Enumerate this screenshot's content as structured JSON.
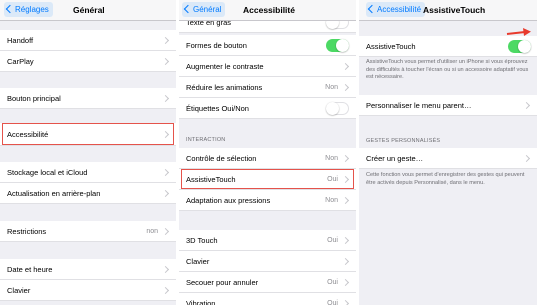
{
  "panel1": {
    "back_label": "Réglages",
    "title": "Général",
    "rows": [
      {
        "label": "Handoff"
      },
      {
        "label": "CarPlay"
      },
      {
        "label": "Bouton principal"
      },
      {
        "label": "Accessibilité"
      },
      {
        "label": "Stockage local et iCloud"
      },
      {
        "label": "Actualisation en arrière-plan"
      },
      {
        "label": "Restrictions",
        "value": "non"
      },
      {
        "label": "Date et heure"
      },
      {
        "label": "Clavier"
      }
    ]
  },
  "panel2": {
    "back_label": "Général",
    "title": "Accessibilité",
    "rows": [
      {
        "label": "Texte en gras"
      },
      {
        "label": "Formes de bouton"
      },
      {
        "label": "Augmenter le contraste"
      },
      {
        "label": "Réduire les animations",
        "value": "Non"
      },
      {
        "label": "Étiquettes Oui/Non"
      },
      {
        "label": "Contrôle de sélection",
        "value": "Non"
      },
      {
        "label": "AssistiveTouch",
        "value": "Oui"
      },
      {
        "label": "Adaptation aux pressions",
        "value": "Non"
      },
      {
        "label": "3D Touch",
        "value": "Oui"
      },
      {
        "label": "Clavier"
      },
      {
        "label": "Secouer pour annuler",
        "value": "Oui"
      },
      {
        "label": "Vibration",
        "value": "Oui"
      }
    ],
    "section_interaction": "INTERACTION"
  },
  "panel3": {
    "back_label": "Accessibilité",
    "title": "AssistiveTouch",
    "toggle_label": "AssistiveTouch",
    "toggle_footer": "AssistiveTouch vous permet d'utiliser un iPhone si vous éprouvez des difficultés à toucher l'écran ou si un accessoire adaptatif vous est nécessaire.",
    "customize_label": "Personnaliser le menu parent…",
    "section_gestures": "GESTES PERSONNALISÉS",
    "create_gesture_label": "Créer un geste…",
    "gesture_footer": "Cette fonction vous permet d'enregistrer des gestes qui peuvent être activés depuis Personnalisé, dans le menu."
  },
  "colors": {
    "accent": "#007aff",
    "toggle_on": "#4cd964",
    "highlight": "#e5534b",
    "background": "#efeff4"
  }
}
